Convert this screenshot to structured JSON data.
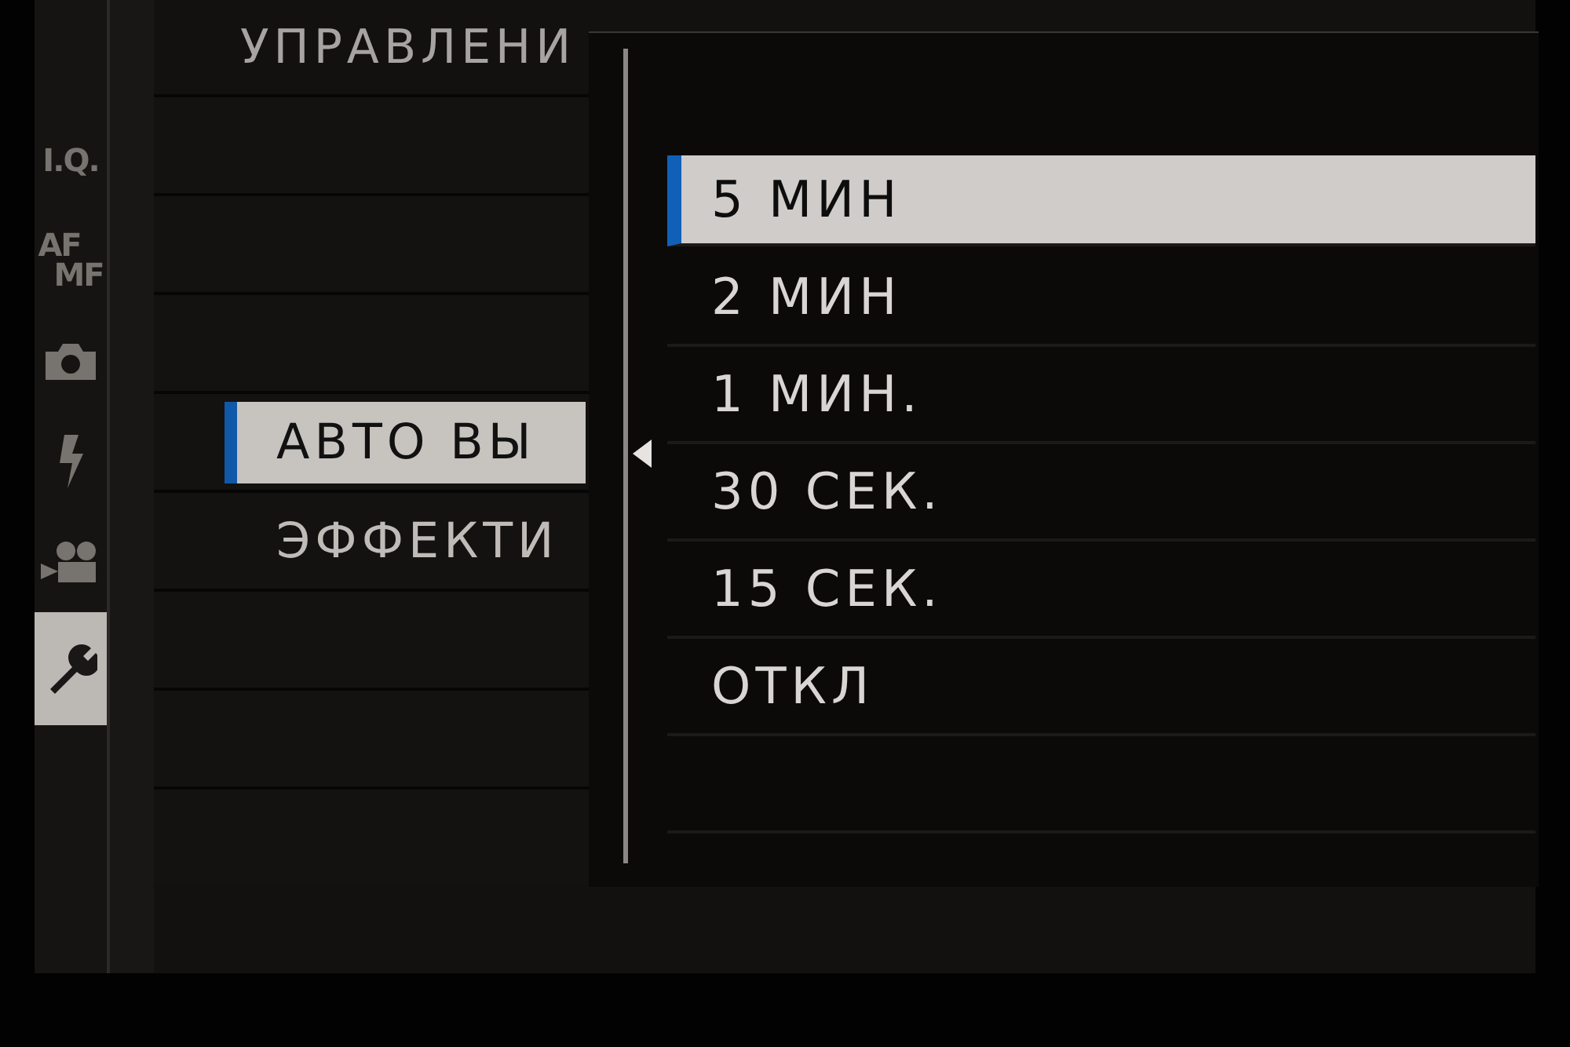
{
  "header": {
    "title": "УПРАВЛЕНИ"
  },
  "tabs": [
    {
      "kind": "text",
      "lines": [
        "I.Q."
      ],
      "selected": false
    },
    {
      "kind": "text",
      "lines": [
        "AF",
        "MF"
      ],
      "selected": false
    },
    {
      "kind": "camera",
      "selected": false
    },
    {
      "kind": "flash",
      "selected": false
    },
    {
      "kind": "movie",
      "selected": false
    },
    {
      "kind": "wrench",
      "selected": true
    }
  ],
  "menu": {
    "items": [
      {
        "label": "АВТО ВЫ",
        "selected": true
      },
      {
        "label": "ЭФФЕКТИ",
        "selected": false
      }
    ]
  },
  "popup": {
    "options": [
      {
        "label": "5 МИН",
        "selected": true
      },
      {
        "label": "2 МИН",
        "selected": false
      },
      {
        "label": "1 МИН.",
        "selected": false
      },
      {
        "label": "30 СЕК.",
        "selected": false
      },
      {
        "label": "15 СЕК.",
        "selected": false
      },
      {
        "label": "ОТКЛ",
        "selected": false
      }
    ]
  }
}
